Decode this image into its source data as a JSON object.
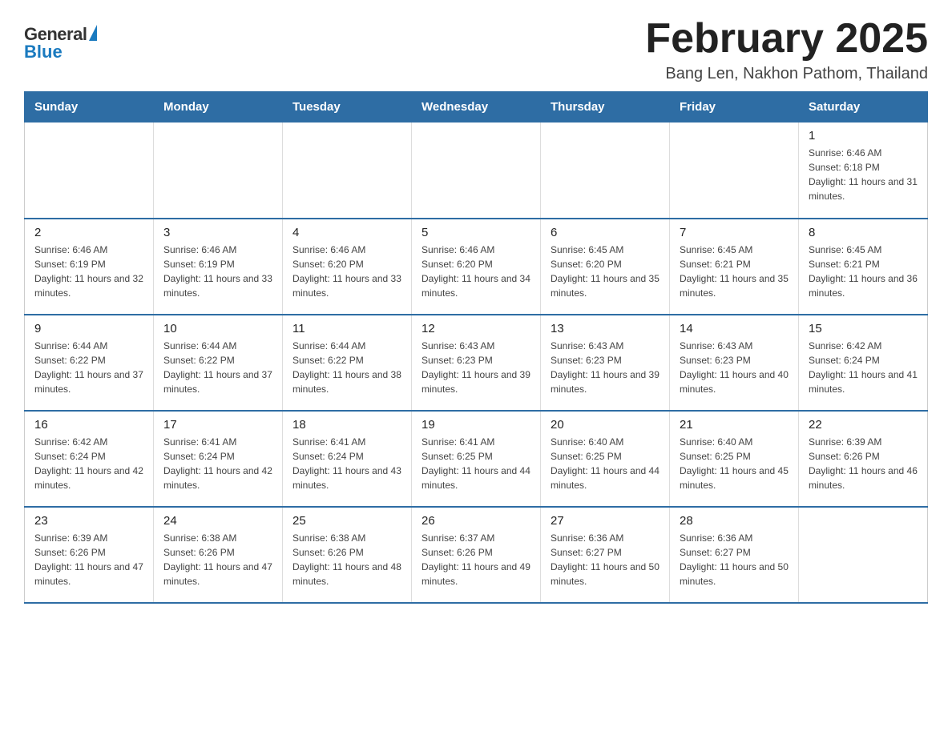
{
  "logo": {
    "general": "General",
    "blue": "Blue"
  },
  "title": "February 2025",
  "subtitle": "Bang Len, Nakhon Pathom, Thailand",
  "days_of_week": [
    "Sunday",
    "Monday",
    "Tuesday",
    "Wednesday",
    "Thursday",
    "Friday",
    "Saturday"
  ],
  "weeks": [
    [
      {
        "day": "",
        "info": ""
      },
      {
        "day": "",
        "info": ""
      },
      {
        "day": "",
        "info": ""
      },
      {
        "day": "",
        "info": ""
      },
      {
        "day": "",
        "info": ""
      },
      {
        "day": "",
        "info": ""
      },
      {
        "day": "1",
        "info": "Sunrise: 6:46 AM\nSunset: 6:18 PM\nDaylight: 11 hours and 31 minutes."
      }
    ],
    [
      {
        "day": "2",
        "info": "Sunrise: 6:46 AM\nSunset: 6:19 PM\nDaylight: 11 hours and 32 minutes."
      },
      {
        "day": "3",
        "info": "Sunrise: 6:46 AM\nSunset: 6:19 PM\nDaylight: 11 hours and 33 minutes."
      },
      {
        "day": "4",
        "info": "Sunrise: 6:46 AM\nSunset: 6:20 PM\nDaylight: 11 hours and 33 minutes."
      },
      {
        "day": "5",
        "info": "Sunrise: 6:46 AM\nSunset: 6:20 PM\nDaylight: 11 hours and 34 minutes."
      },
      {
        "day": "6",
        "info": "Sunrise: 6:45 AM\nSunset: 6:20 PM\nDaylight: 11 hours and 35 minutes."
      },
      {
        "day": "7",
        "info": "Sunrise: 6:45 AM\nSunset: 6:21 PM\nDaylight: 11 hours and 35 minutes."
      },
      {
        "day": "8",
        "info": "Sunrise: 6:45 AM\nSunset: 6:21 PM\nDaylight: 11 hours and 36 minutes."
      }
    ],
    [
      {
        "day": "9",
        "info": "Sunrise: 6:44 AM\nSunset: 6:22 PM\nDaylight: 11 hours and 37 minutes."
      },
      {
        "day": "10",
        "info": "Sunrise: 6:44 AM\nSunset: 6:22 PM\nDaylight: 11 hours and 37 minutes."
      },
      {
        "day": "11",
        "info": "Sunrise: 6:44 AM\nSunset: 6:22 PM\nDaylight: 11 hours and 38 minutes."
      },
      {
        "day": "12",
        "info": "Sunrise: 6:43 AM\nSunset: 6:23 PM\nDaylight: 11 hours and 39 minutes."
      },
      {
        "day": "13",
        "info": "Sunrise: 6:43 AM\nSunset: 6:23 PM\nDaylight: 11 hours and 39 minutes."
      },
      {
        "day": "14",
        "info": "Sunrise: 6:43 AM\nSunset: 6:23 PM\nDaylight: 11 hours and 40 minutes."
      },
      {
        "day": "15",
        "info": "Sunrise: 6:42 AM\nSunset: 6:24 PM\nDaylight: 11 hours and 41 minutes."
      }
    ],
    [
      {
        "day": "16",
        "info": "Sunrise: 6:42 AM\nSunset: 6:24 PM\nDaylight: 11 hours and 42 minutes."
      },
      {
        "day": "17",
        "info": "Sunrise: 6:41 AM\nSunset: 6:24 PM\nDaylight: 11 hours and 42 minutes."
      },
      {
        "day": "18",
        "info": "Sunrise: 6:41 AM\nSunset: 6:24 PM\nDaylight: 11 hours and 43 minutes."
      },
      {
        "day": "19",
        "info": "Sunrise: 6:41 AM\nSunset: 6:25 PM\nDaylight: 11 hours and 44 minutes."
      },
      {
        "day": "20",
        "info": "Sunrise: 6:40 AM\nSunset: 6:25 PM\nDaylight: 11 hours and 44 minutes."
      },
      {
        "day": "21",
        "info": "Sunrise: 6:40 AM\nSunset: 6:25 PM\nDaylight: 11 hours and 45 minutes."
      },
      {
        "day": "22",
        "info": "Sunrise: 6:39 AM\nSunset: 6:26 PM\nDaylight: 11 hours and 46 minutes."
      }
    ],
    [
      {
        "day": "23",
        "info": "Sunrise: 6:39 AM\nSunset: 6:26 PM\nDaylight: 11 hours and 47 minutes."
      },
      {
        "day": "24",
        "info": "Sunrise: 6:38 AM\nSunset: 6:26 PM\nDaylight: 11 hours and 47 minutes."
      },
      {
        "day": "25",
        "info": "Sunrise: 6:38 AM\nSunset: 6:26 PM\nDaylight: 11 hours and 48 minutes."
      },
      {
        "day": "26",
        "info": "Sunrise: 6:37 AM\nSunset: 6:26 PM\nDaylight: 11 hours and 49 minutes."
      },
      {
        "day": "27",
        "info": "Sunrise: 6:36 AM\nSunset: 6:27 PM\nDaylight: 11 hours and 50 minutes."
      },
      {
        "day": "28",
        "info": "Sunrise: 6:36 AM\nSunset: 6:27 PM\nDaylight: 11 hours and 50 minutes."
      },
      {
        "day": "",
        "info": ""
      }
    ]
  ]
}
